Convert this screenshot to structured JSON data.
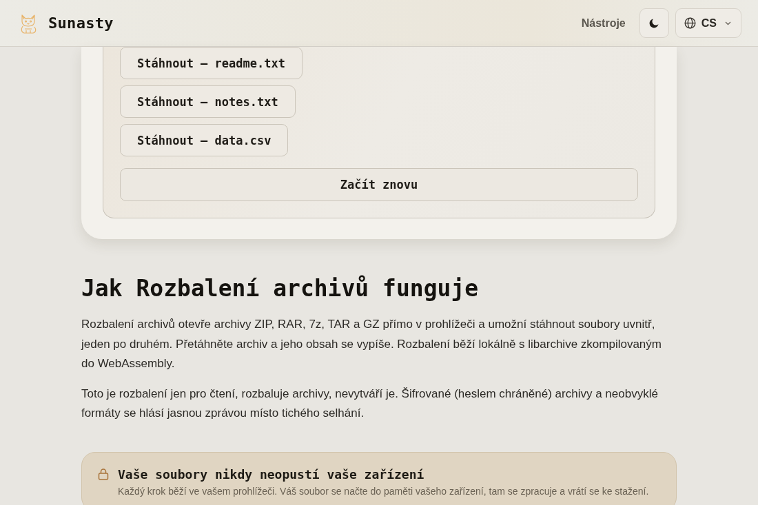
{
  "header": {
    "brand": "Sunasty",
    "nav_link": "Nástroje",
    "language": "CS"
  },
  "result_card": {
    "download_buttons": [
      "Stáhnout – readme.txt",
      "Stáhnout – notes.txt",
      "Stáhnout – data.csv"
    ],
    "restart_button": "Začít znovu"
  },
  "article": {
    "heading": "Jak Rozbalení archivů funguje",
    "paragraphs": [
      "Rozbalení archivů otevře archivy ZIP, RAR, 7z, TAR a GZ přímo v prohlížeči a umožní stáhnout soubory uvnitř, jeden po druhém. Přetáhněte archiv a jeho obsah se vypíše. Rozbalení běží lokálně s libarchive zkompilovaným do WebAssembly.",
      "Toto je rozbalení jen pro čtení, rozbaluje archivy, nevytváří je. Šifrované (heslem chráněné) archivy a neobvyklé formáty se hlásí jasnou zprávou místo tichého selhání."
    ]
  },
  "privacy_notice": {
    "title": "Vaše soubory nikdy neopustí vaše zařízení",
    "text": "Každý krok běží ve vašem prohlížeči. Váš soubor se načte do paměti vašeho zařízení, tam se zpracuje a vrátí se ke stažení."
  }
}
